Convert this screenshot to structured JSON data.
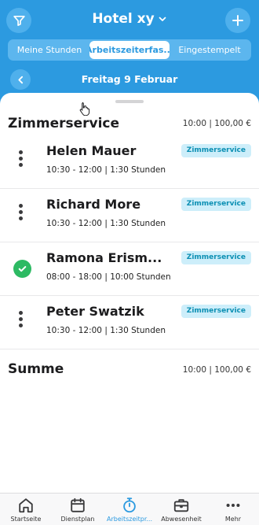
{
  "header": {
    "title": "Hotel xy",
    "tabs": [
      {
        "label": "Meine Stunden",
        "active": false
      },
      {
        "label": "Arbeitszeiterfas...",
        "active": true
      },
      {
        "label": "Eingestempelt",
        "active": false
      }
    ],
    "date": "Freitag 9 Februar",
    "accent_color": "#2c9ae0"
  },
  "section": {
    "title": "Zimmerservice",
    "summary": "10:00 | 100,00 €"
  },
  "entries": [
    {
      "name": "Helen Mauer",
      "time": "10:30 - 12:00 | 1:30 Stunden",
      "badge": "Zimmerservice",
      "status": "menu"
    },
    {
      "name": "Richard More",
      "time": "10:30 - 12:00 | 1:30 Stunden",
      "badge": "Zimmerservice",
      "status": "menu"
    },
    {
      "name": "Ramona Erism...",
      "time": "08:00 - 18:00 | 10:00 Stunden",
      "badge": "Zimmerservice",
      "status": "approved"
    },
    {
      "name": "Peter Swatzik",
      "time": "10:30 - 12:00 | 1:30 Stunden",
      "badge": "Zimmerservice",
      "status": "menu"
    }
  ],
  "total": {
    "label": "Summe",
    "value": "10:00 | 100,00 €"
  },
  "tabbar": [
    {
      "label": "Startseite",
      "icon": "home-icon",
      "active": false
    },
    {
      "label": "Dienstplan",
      "icon": "calendar-icon",
      "active": false
    },
    {
      "label": "Arbeitszeitpr...",
      "icon": "stopwatch-icon",
      "active": true
    },
    {
      "label": "Abwesenheit",
      "icon": "briefcase-icon",
      "active": false
    },
    {
      "label": "Mehr",
      "icon": "more-icon",
      "active": false
    }
  ]
}
